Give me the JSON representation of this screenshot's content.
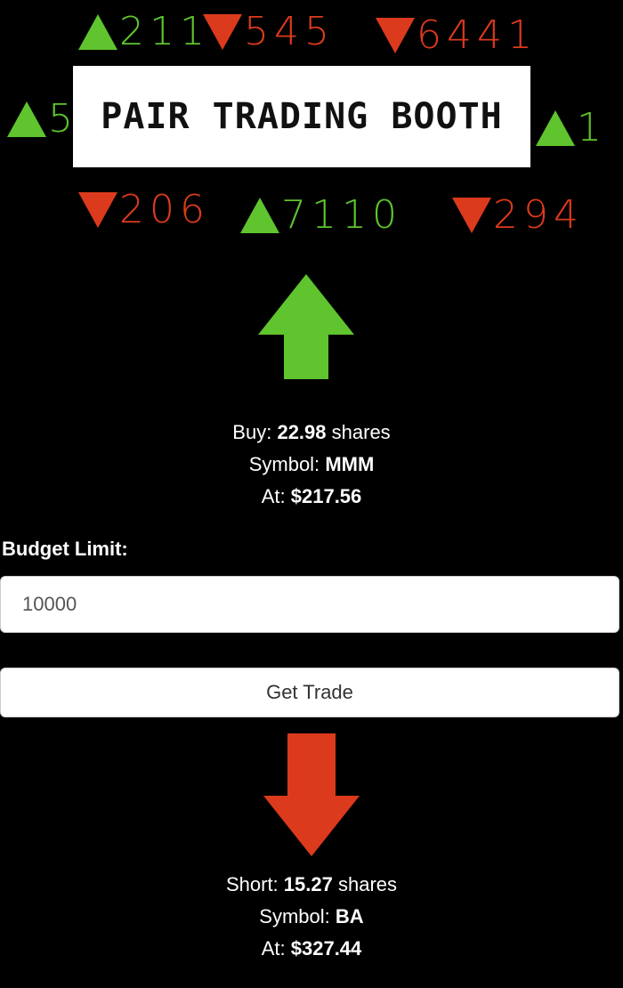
{
  "banner": {
    "title": "PAIR TRADING BOOTH",
    "top_row": [
      {
        "direction": "up",
        "value": "211"
      },
      {
        "direction": "down",
        "value": "545"
      },
      {
        "direction": "down",
        "value": "6441"
      }
    ],
    "left_side": {
      "direction": "up",
      "value": "5"
    },
    "right_side": {
      "direction": "up",
      "value": "1"
    },
    "bottom_row": [
      {
        "direction": "down",
        "value": "206"
      },
      {
        "direction": "up",
        "value": "7110"
      },
      {
        "direction": "down",
        "value": "294"
      }
    ]
  },
  "colors": {
    "up": "#5fc42e",
    "down": "#dc3a1d",
    "background": "#000000"
  },
  "buy": {
    "label": "Buy:",
    "shares": "22.98",
    "shares_unit": "shares",
    "symbol_label": "Symbol:",
    "symbol": "MMM",
    "price_label": "At:",
    "price": "$217.56"
  },
  "form": {
    "budget_label": "Budget Limit:",
    "budget_value": "10000",
    "button_label": "Get Trade"
  },
  "short": {
    "label": "Short:",
    "shares": "15.27",
    "shares_unit": "shares",
    "symbol_label": "Symbol:",
    "symbol": "BA",
    "price_label": "At:",
    "price": "$327.44"
  }
}
